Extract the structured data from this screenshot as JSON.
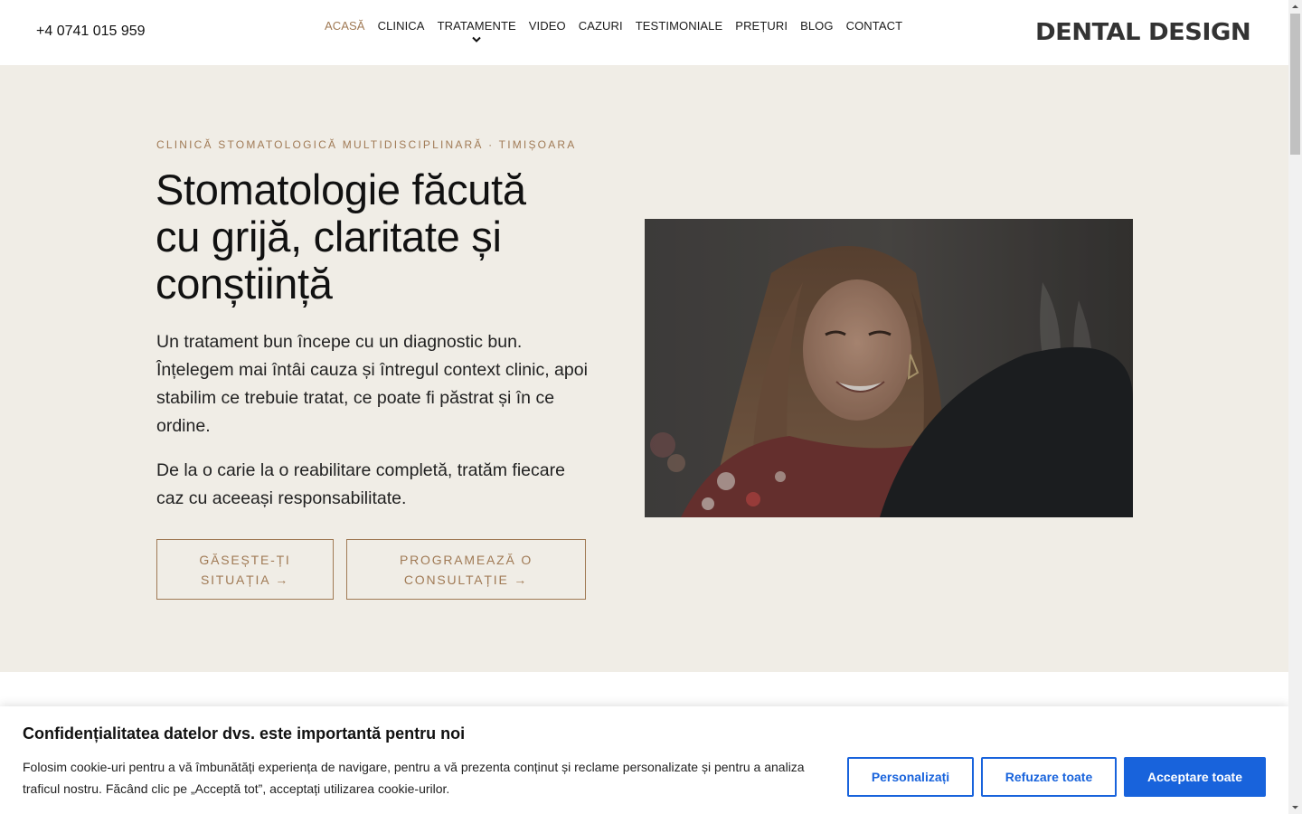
{
  "header": {
    "phone": "+4 0741 015 959",
    "logo": "DENTAL DESIGN",
    "nav": [
      {
        "label": "ACASĂ",
        "active": true
      },
      {
        "label": "CLINICA"
      },
      {
        "label": "TRATAMENTE",
        "dropdown": true
      },
      {
        "label": "VIDEO"
      },
      {
        "label": "CAZURI"
      },
      {
        "label": "TESTIMONIALE"
      },
      {
        "label": "PREȚURI"
      },
      {
        "label": "BLOG"
      },
      {
        "label": "CONTACT"
      }
    ]
  },
  "hero": {
    "eyebrow": "CLINICĂ STOMATOLOGICĂ MULTIDISCIPLINARĂ · TIMIȘOARA",
    "headline": "Stomatologie făcută cu grijă, claritate și conștiință",
    "paragraph1": "Un tratament bun începe cu un diagnostic bun. Înțelegem mai întâi cauza și întregul context clinic, apoi stabilim ce trebuie tratat, ce poate fi păstrat și în ce ordine.",
    "paragraph2": "De la o carie la o reabilitare completă, tratăm fiecare caz cu aceeași responsabilitate.",
    "button1": "GĂSEȘTE-ȚI SITUAȚIA →",
    "button2": "PROGRAMEAZĂ O CONSULTAȚIE →"
  },
  "cookie": {
    "title": "Confidențialitatea datelor dvs. este importantă pentru noi",
    "text": "Folosim cookie-uri pentru a vă îmbunătăți experiența de navigare, pentru a vă prezenta conținut și reclame personalizate și pentru a analiza traficul nostru. Făcând clic pe „Acceptă tot”, acceptați utilizarea cookie-urilor.",
    "customize": "Personalizați",
    "reject": "Refuzare toate",
    "accept": "Acceptare toate"
  },
  "colors": {
    "accent": "#a07a55",
    "hero_bg": "#f0ede6",
    "primary_blue": "#1863dc"
  }
}
